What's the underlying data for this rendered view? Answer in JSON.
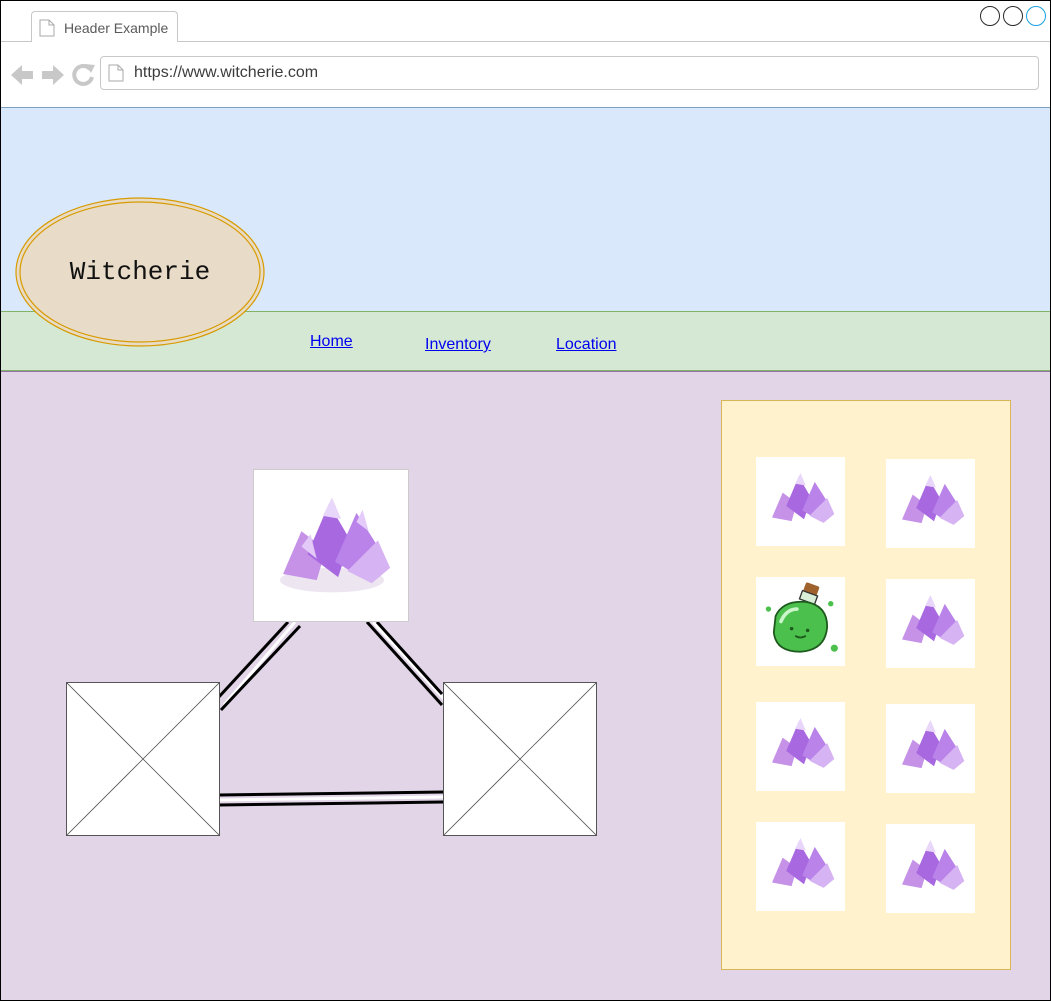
{
  "browser": {
    "tab_title": "Header Example",
    "url": "https://www.witcherie.com"
  },
  "site": {
    "logo_text": "Witcherie",
    "nav": {
      "home": "Home",
      "inventory": "Inventory",
      "location": "Location"
    }
  },
  "colors": {
    "header_band": "#dae8fc",
    "nav_band": "#d5e8d4",
    "content": "#e1d5e7",
    "inventory_panel": "#fff2cc",
    "logo_fill": "#e8dcc8",
    "logo_border": "#d79b00"
  },
  "inventory": {
    "slots": [
      "crystal",
      "crystal",
      "potion",
      "crystal",
      "crystal",
      "crystal",
      "crystal",
      "crystal"
    ]
  }
}
